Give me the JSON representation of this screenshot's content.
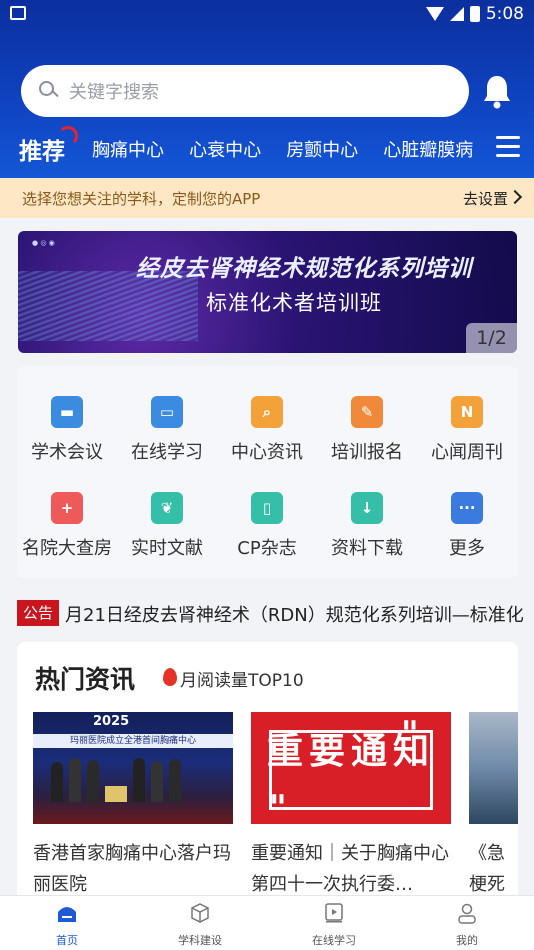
{
  "statusbar": {
    "time": "5:08"
  },
  "search": {
    "placeholder": "关键字搜索"
  },
  "nav": {
    "active": "推荐",
    "items": [
      "胸痛中心",
      "心衰中心",
      "房颤中心",
      "心脏瓣膜病"
    ]
  },
  "notice": {
    "text": "选择您想关注的学科，定制您的APP",
    "link": "去设置"
  },
  "banner": {
    "title_line1": "经皮去肾神经术规范化系列培训",
    "title_line2": "标准化术者培训班",
    "page": "1/2"
  },
  "grid": [
    {
      "label": "学术会议",
      "icon": "building-icon",
      "color": "#3b8be0"
    },
    {
      "label": "在线学习",
      "icon": "monitor-icon",
      "color": "#3b8be0"
    },
    {
      "label": "中心资讯",
      "icon": "search-doc-icon",
      "color": "#f3a23a"
    },
    {
      "label": "培训报名",
      "icon": "edit-icon",
      "color": "#f08a3a"
    },
    {
      "label": "心闻周刊",
      "icon": "news-icon",
      "color": "#f3a23a"
    },
    {
      "label": "名院大查房",
      "icon": "hospital-bed-icon",
      "color": "#ee5a5a"
    },
    {
      "label": "实时文献",
      "icon": "leaf-icon",
      "color": "#36bfa8"
    },
    {
      "label": "CP杂志",
      "icon": "book-icon",
      "color": "#36bfa8"
    },
    {
      "label": "资料下载",
      "icon": "cloud-download-icon",
      "color": "#36bfa8"
    },
    {
      "label": "更多",
      "icon": "more-icon",
      "color": "#3b7be0"
    }
  ],
  "announce": {
    "tag": "公告",
    "text": "月21日经皮去肾神经术（RDN）规范化系列培训—标准化"
  },
  "hot": {
    "title": "热门资讯",
    "subtitle": "月阅读量TOP10",
    "items": [
      {
        "text": "香港首家胸痛中心落户玛丽医院",
        "image_year": "2025",
        "image_caption": "玛丽医院成立全港首间胸痛中心"
      },
      {
        "text": "重要通知｜关于胸痛中心第四十一次执行委…",
        "image_text": "重要通知"
      },
      {
        "text": "《急梗死"
      }
    ]
  },
  "tabbar": [
    "首页",
    "学科建设",
    "在线学习",
    "我的"
  ]
}
